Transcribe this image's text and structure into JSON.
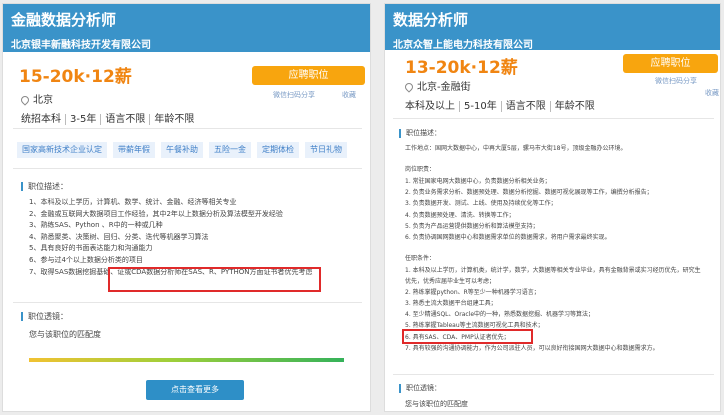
{
  "left": {
    "title": "金融数据分析师",
    "company": "北京银丰新融科技开发有限公司",
    "salary": "15-20k·12薪",
    "apply_label": "应聘职位",
    "share_wechat": "微信扫码分享",
    "favorite": "收藏",
    "location": "北京",
    "requirements": [
      "统招本科",
      "3-5年",
      "语言不限",
      "年龄不限"
    ],
    "tags": [
      "国家高新技术企业认定",
      "带薪年假",
      "午餐补助",
      "五险一金",
      "定期体检",
      "节日礼物"
    ],
    "desc_title": "职位描述：",
    "desc_items": [
      "1、本科及以上学历，计算机、数学、统计、金融、经济等相关专业",
      "2、金融或互联网大数据项目工作经验，其中2年以上数据分析及算法模型开发经验",
      "3、熟练SAS、Python 、R中的一种或几种",
      "4、熟悉聚类、决策树、回归、分类、迭代等机器学习算法",
      "5、具有良好的书面表达能力和沟通能力",
      "6、参与过4个以上数据分析类的项目",
      "7、取得SAS数据挖掘基础、证或CDA数据分析师在SAS、R、PYTHON方面证书者优先考虑"
    ],
    "match_title": "职位透镜：",
    "match_text": "您与该职位的匹配度",
    "more_label": "点击查看更多"
  },
  "right": {
    "title": "数据分析师",
    "company": "北京众智上能电力科技有限公司",
    "salary": "13-20k·12薪",
    "apply_label": "应聘职位",
    "share_wechat": "微信扫码分享",
    "favorite": "收藏",
    "location": "北京-金融街",
    "requirements": [
      "本科及以上",
      "5-10年",
      "语言不限",
      "年龄不限"
    ],
    "desc_title": "职位描述：",
    "work_location": "工作地点：国网大数据中心，中再大厦5层，骡马市大街18号，顶级金融办公环境。",
    "duties_title": "岗位职责：",
    "duties": [
      "1. 常驻国家电网大数据中心，负责数据分析相关业务；",
      "2. 负责业务需求分析、数据预处理、数据分析挖掘、数据可视化展现等工作，编撰分析报告；",
      "3. 负责数据开发、测试、上线、使用及持续优化等工作；",
      "4. 负责数据预处理、清洗、转换等工作；",
      "5. 负责为产品运营提供数据分析和算法模型支持；",
      "6. 负责协调国网数据中心和数据需求单位的数据需求，将用户需求最终实现。"
    ],
    "qual_title": "任职条件：",
    "quals": [
      "1. 本科及以上学历，计算机类，统计学，数学，大数据等相关专业毕业，具有金融背景或实习经历优先，研究生",
      "优先，优秀应届毕业生可以考虑；",
      "2. 熟练掌握python、R等至少一种机器学习语言；",
      "3. 熟悉主流大数据平台组建工具；",
      "4. 至少精通SQL、Oracle中的一种，熟悉数据挖掘、机器学习等算法；",
      "5. 熟练掌握Tableau等主流数据可视化工具和技术；",
      "6. 具有SAS、CDA、PMP认证者优先；",
      "7. 具有较强的沟通协调能力，作为公司派驻人员，可以良好衔接国网大数据中心和数据需求方。"
    ],
    "match_title": "职位透镜：",
    "match_text": "您与该职位的匹配度"
  }
}
